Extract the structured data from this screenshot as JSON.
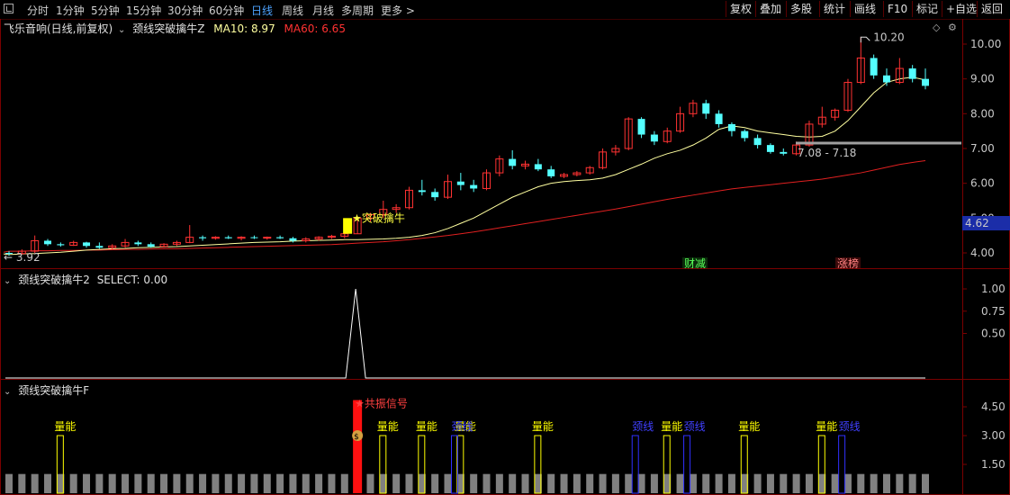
{
  "toolbar": {
    "periods": [
      "分时",
      "1分钟",
      "5分钟",
      "15分钟",
      "30分钟",
      "60分钟",
      "日线",
      "周线",
      "月线",
      "多周期",
      "更多 >"
    ],
    "active_period": "日线",
    "buttons": [
      "复权",
      "叠加",
      "多股",
      "统计",
      "画线",
      "F10",
      "标记",
      "+自选",
      "返回"
    ]
  },
  "main_panel": {
    "stock_title": "飞乐音响(日线,前复权)",
    "indicator_name": "颈线突破擒牛Z",
    "ma10_label": "MA10: 8.97",
    "ma60_label": "MA60: 6.65",
    "y_ticks": [
      "10.00",
      "9.00",
      "8.00",
      "7.00",
      "6.00",
      "5.00",
      "4.00"
    ],
    "current_price_tag": "4.62",
    "high_annotation": "10.20",
    "low_annotation": "3.92",
    "range_annotation": "7.08 - 7.18",
    "breakout_label": "★突破擒牛",
    "tag_caijian": "财减",
    "tag_zhangbang": "涨榜"
  },
  "select_panel": {
    "title": "颈线突破擒牛2",
    "select_label": "SELECT: 0.00",
    "y_ticks": [
      "1.00",
      "0.75",
      "0.50"
    ]
  },
  "f_panel": {
    "title": "颈线突破擒牛F",
    "signal_label": "★共振信号",
    "volume_label": "量能",
    "neckline_label": "颈线",
    "y_ticks": [
      "4.50",
      "3.00",
      "1.50"
    ]
  },
  "colors": {
    "up": "#ff3232",
    "down": "#54ffff",
    "ma10": "#ffffa0",
    "ma60": "#e02020",
    "border": "#7a0000",
    "yellow": "#ffff00",
    "blue": "#3030ff"
  },
  "chart_data": {
    "type": "candlestick",
    "title": "飞乐音响(日线,前复权)",
    "ylim": [
      3.7,
      10.5
    ],
    "series": [
      {
        "name": "MA10",
        "values": [
          3.95,
          3.97,
          3.98,
          4.0,
          4.02,
          4.05,
          4.08,
          4.1,
          4.12,
          4.13,
          4.15,
          4.16,
          4.17,
          4.18,
          4.2,
          4.22,
          4.24,
          4.26,
          4.28,
          4.3,
          4.31,
          4.32,
          4.34,
          4.35,
          4.36,
          4.37,
          4.38,
          4.38,
          4.39,
          4.4,
          4.42,
          4.45,
          4.5,
          4.58,
          4.7,
          4.85,
          5.0,
          5.2,
          5.4,
          5.6,
          5.75,
          5.9,
          6.0,
          6.05,
          6.08,
          6.1,
          6.15,
          6.25,
          6.4,
          6.55,
          6.72,
          6.85,
          6.95,
          7.1,
          7.3,
          7.55,
          7.65,
          7.6,
          7.5,
          7.45,
          7.4,
          7.35,
          7.33,
          7.35,
          7.5,
          7.8,
          8.2,
          8.6,
          8.9,
          9.0,
          9.05,
          8.97
        ]
      },
      {
        "name": "MA60",
        "values": [
          4.05,
          4.05,
          4.06,
          4.06,
          4.07,
          4.07,
          4.08,
          4.08,
          4.09,
          4.1,
          4.1,
          4.11,
          4.12,
          4.12,
          4.13,
          4.14,
          4.15,
          4.16,
          4.17,
          4.18,
          4.19,
          4.2,
          4.21,
          4.22,
          4.23,
          4.24,
          4.26,
          4.28,
          4.3,
          4.32,
          4.35,
          4.38,
          4.42,
          4.46,
          4.5,
          4.55,
          4.6,
          4.66,
          4.72,
          4.78,
          4.84,
          4.9,
          4.96,
          5.02,
          5.08,
          5.14,
          5.2,
          5.26,
          5.33,
          5.4,
          5.47,
          5.54,
          5.6,
          5.66,
          5.72,
          5.78,
          5.84,
          5.88,
          5.92,
          5.96,
          6.0,
          6.04,
          6.08,
          6.12,
          6.18,
          6.24,
          6.3,
          6.38,
          6.46,
          6.54,
          6.6,
          6.65
        ]
      }
    ],
    "candles_ohlc": [
      [
        4.0,
        4.05,
        3.92,
        3.98
      ],
      [
        3.98,
        4.1,
        3.95,
        4.05
      ],
      [
        4.05,
        4.5,
        4.0,
        4.35
      ],
      [
        4.35,
        4.4,
        4.2,
        4.25
      ],
      [
        4.25,
        4.3,
        4.18,
        4.22
      ],
      [
        4.22,
        4.35,
        4.2,
        4.3
      ],
      [
        4.3,
        4.32,
        4.15,
        4.2
      ],
      [
        4.2,
        4.3,
        4.12,
        4.15
      ],
      [
        4.15,
        4.25,
        4.1,
        4.2
      ],
      [
        4.2,
        4.4,
        4.15,
        4.3
      ],
      [
        4.3,
        4.35,
        4.2,
        4.25
      ],
      [
        4.25,
        4.3,
        4.15,
        4.18
      ],
      [
        4.18,
        4.28,
        4.15,
        4.25
      ],
      [
        4.25,
        4.35,
        4.2,
        4.3
      ],
      [
        4.3,
        4.8,
        4.28,
        4.45
      ],
      [
        4.45,
        4.5,
        4.35,
        4.42
      ],
      [
        4.42,
        4.48,
        4.38,
        4.45
      ],
      [
        4.45,
        4.5,
        4.4,
        4.42
      ],
      [
        4.42,
        4.48,
        4.36,
        4.45
      ],
      [
        4.45,
        4.5,
        4.4,
        4.43
      ],
      [
        4.43,
        4.47,
        4.38,
        4.45
      ],
      [
        4.45,
        4.5,
        4.4,
        4.42
      ],
      [
        4.42,
        4.46,
        4.3,
        4.35
      ],
      [
        4.35,
        4.45,
        4.3,
        4.4
      ],
      [
        4.4,
        4.48,
        4.35,
        4.45
      ],
      [
        4.45,
        4.52,
        4.4,
        4.48
      ],
      [
        4.48,
        4.6,
        4.42,
        4.55
      ],
      [
        4.55,
        5.05,
        4.55,
        5.0
      ],
      [
        5.0,
        5.15,
        4.9,
        5.1
      ],
      [
        5.1,
        5.5,
        5.0,
        5.25
      ],
      [
        5.25,
        5.4,
        5.15,
        5.3
      ],
      [
        5.3,
        5.9,
        5.25,
        5.8
      ],
      [
        5.8,
        6.1,
        5.65,
        5.75
      ],
      [
        5.75,
        5.85,
        5.5,
        5.6
      ],
      [
        5.6,
        6.25,
        5.55,
        6.05
      ],
      [
        6.05,
        6.3,
        5.8,
        5.95
      ],
      [
        5.95,
        6.1,
        5.75,
        5.85
      ],
      [
        5.85,
        6.4,
        5.8,
        6.3
      ],
      [
        6.3,
        6.8,
        6.2,
        6.7
      ],
      [
        6.7,
        6.95,
        6.4,
        6.5
      ],
      [
        6.5,
        6.65,
        6.4,
        6.55
      ],
      [
        6.55,
        6.7,
        6.35,
        6.4
      ],
      [
        6.4,
        6.5,
        6.15,
        6.2
      ],
      [
        6.2,
        6.3,
        6.15,
        6.25
      ],
      [
        6.25,
        6.35,
        6.2,
        6.3
      ],
      [
        6.3,
        6.5,
        6.25,
        6.45
      ],
      [
        6.45,
        7.0,
        6.4,
        6.9
      ],
      [
        6.9,
        7.1,
        6.8,
        7.0
      ],
      [
        7.0,
        7.9,
        6.95,
        7.85
      ],
      [
        7.85,
        7.9,
        7.3,
        7.4
      ],
      [
        7.4,
        7.5,
        7.1,
        7.2
      ],
      [
        7.2,
        7.6,
        7.15,
        7.5
      ],
      [
        7.5,
        8.2,
        7.45,
        8.0
      ],
      [
        8.0,
        8.4,
        7.9,
        8.3
      ],
      [
        8.3,
        8.4,
        7.85,
        8.0
      ],
      [
        8.0,
        8.1,
        7.6,
        7.7
      ],
      [
        7.7,
        7.75,
        7.35,
        7.5
      ],
      [
        7.5,
        7.55,
        7.2,
        7.3
      ],
      [
        7.3,
        7.4,
        7.0,
        7.1
      ],
      [
        7.1,
        7.15,
        6.85,
        6.9
      ],
      [
        6.9,
        7.0,
        6.8,
        6.85
      ],
      [
        6.85,
        7.2,
        6.8,
        7.1
      ],
      [
        7.1,
        7.8,
        7.05,
        7.7
      ],
      [
        7.7,
        8.2,
        7.6,
        7.9
      ],
      [
        7.9,
        8.15,
        7.8,
        8.1
      ],
      [
        8.1,
        9.0,
        8.05,
        8.9
      ],
      [
        8.9,
        10.2,
        8.85,
        9.6
      ],
      [
        9.6,
        9.7,
        9.0,
        9.1
      ],
      [
        9.1,
        9.3,
        8.8,
        8.9
      ],
      [
        8.9,
        9.6,
        8.85,
        9.3
      ],
      [
        9.3,
        9.4,
        8.9,
        9.0
      ],
      [
        9.0,
        9.3,
        8.7,
        8.8
      ]
    ]
  }
}
